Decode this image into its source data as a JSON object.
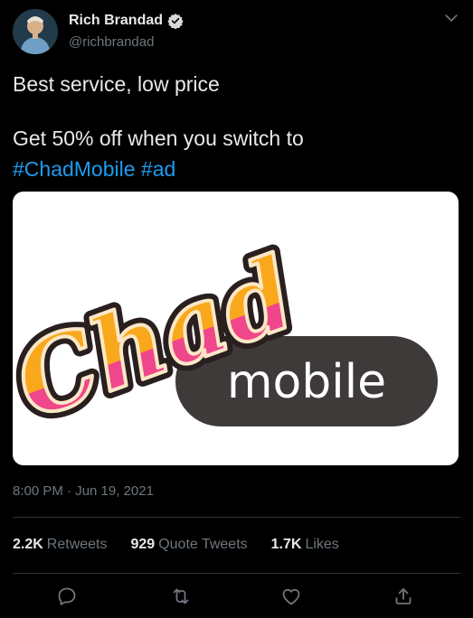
{
  "tweet": {
    "author_name": "Rich Brandad",
    "author_handle": "@richbrandad",
    "line1": "Best service, low price",
    "line2_prefix": "Get 50% off when you switch to",
    "hashtags": [
      "#ChadMobile",
      "#ad"
    ],
    "timestamp": "8:00 PM · Jun 19, 2021",
    "media": {
      "logo_word": "Chad",
      "logo_sub": "mobile"
    },
    "stats": [
      {
        "count": "2.2K",
        "label": "Retweets"
      },
      {
        "count": "929",
        "label": "Quote Tweets"
      },
      {
        "count": "1.7K",
        "label": "Likes"
      }
    ]
  },
  "icons": {
    "verified": "verified-badge-icon",
    "menu": "chevron-down-icon",
    "reply": "reply-icon",
    "retweet": "retweet-icon",
    "like": "heart-icon",
    "share": "share-icon"
  },
  "colors": {
    "background": "#000000",
    "link": "#1d9bf0",
    "muted": "#6e767d",
    "logo_orange": "#f9a81b",
    "logo_pink": "#f0468c",
    "logo_pill": "#3e3a3a"
  }
}
